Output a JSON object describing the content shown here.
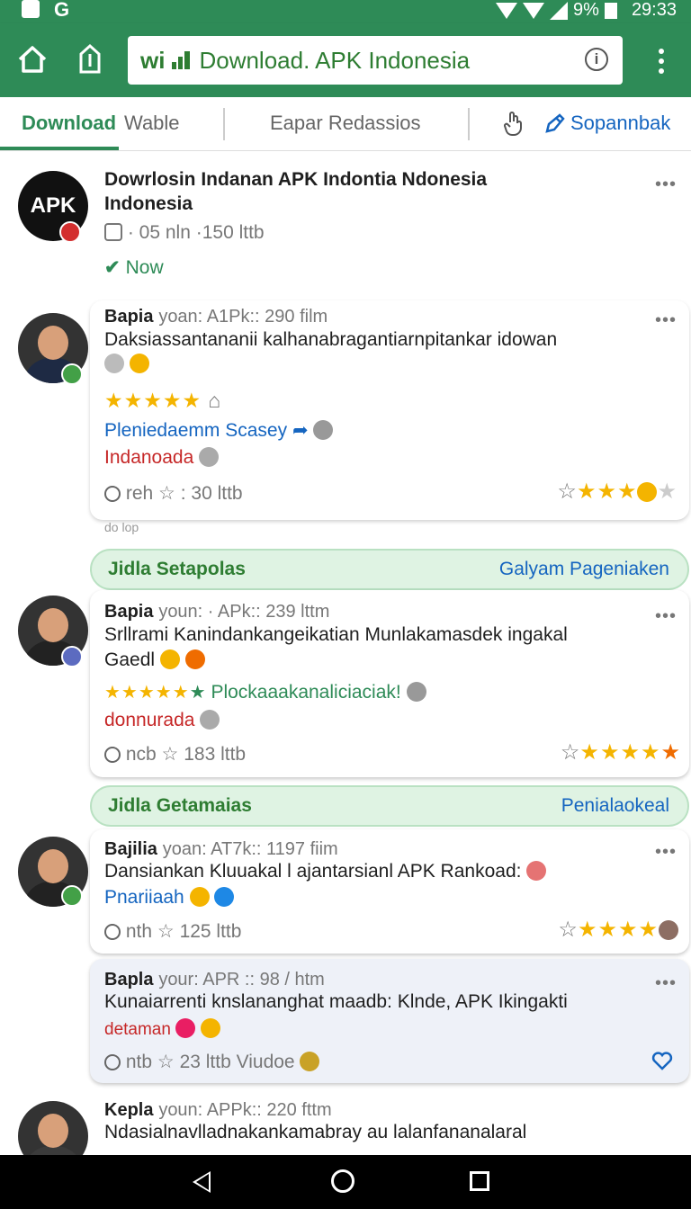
{
  "status": {
    "battery": "9%",
    "time": "29:33",
    "google_letter": "G"
  },
  "toolbar": {
    "url_prefix": "wi",
    "url_text": "Download. APK Indonesia",
    "info_glyph": "i"
  },
  "tabs": {
    "items": [
      "Download",
      "Wable",
      "Eapar Redassios"
    ],
    "link": "Sopannbak"
  },
  "feed": {
    "header_post": {
      "logo": "APK",
      "title_line1": "Dowrlosin Indanan APK Indontia Ndonesia",
      "title_line2": "Indonesia",
      "meta": "· 05 nln ·150 lttb",
      "status": "Now"
    },
    "post1": {
      "name": "Bapia",
      "meta": "yoan: A1Pk:: 290 film",
      "text": "Daksiassantananii kalhanabragantiarnpitankar idowan",
      "link": "Pleniedaemm Scasey",
      "location": "Indanoada",
      "footer": "reh",
      "footer2": ": 30 lttb"
    },
    "partial_text": "do lop",
    "pill1": {
      "left": "Jidla Setapolas",
      "right": "Galyam Pageniaken"
    },
    "post2": {
      "name": "Bapia",
      "meta": "youn: · APk:: 239 lttm",
      "text": "Srllrami Kanindankangeikatian Munlakamasdek ingakal",
      "text2": "Gaedl",
      "rating_text": "Plockaaakanaliciaciak!",
      "location": "donnurada",
      "footer": "ncb",
      "footer2": "183 lttb"
    },
    "pill2": {
      "left": "Jidla Getamaias",
      "right": "Penialaokeal"
    },
    "post3": {
      "name": "Bajilia",
      "meta": "yoan: AT7k:: 1197 fiim",
      "text": "Dansiankan Kluuakal l ajantarsianl APK Rankoad:",
      "link": "Pnariiaah",
      "footer": "nth",
      "footer2": "125 lttb"
    },
    "post4": {
      "name": "Bapla",
      "meta": "your: APR :: 98 / htm",
      "text": "Kunaiarrenti knslananghat maadb: Klnde, APK Ikingakti",
      "location": "detaman",
      "footer": "ntb",
      "footer2": "23 lttb Viudoe"
    },
    "post5": {
      "name": "Kepla",
      "meta": "youn: APPk:: 220 fttm",
      "text": "Ndasialnavlladnakankamabray au lalanfananalaral"
    }
  },
  "colors": {
    "brand": "#2e8b57",
    "link": "#1565c0",
    "star": "#f4b400",
    "location": "#c62828"
  }
}
